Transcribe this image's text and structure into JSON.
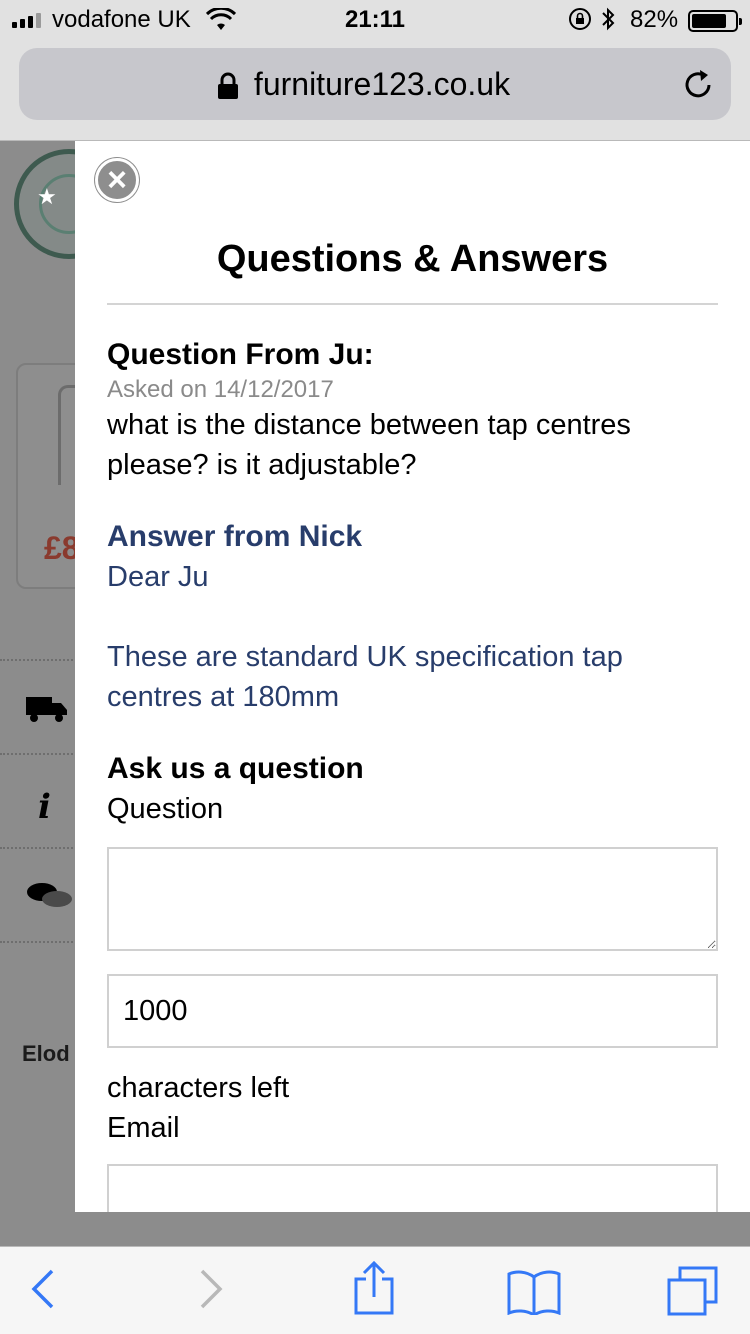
{
  "status_bar": {
    "carrier": "vodafone UK",
    "time": "21:11",
    "battery_percent": "82%",
    "battery_level": 0.82,
    "signal_bars": 3
  },
  "browser": {
    "url": "furniture123.co.uk",
    "icons": [
      "lock-icon",
      "reload-icon",
      "back-icon",
      "forward-icon",
      "share-icon",
      "bookmarks-icon",
      "tabs-icon"
    ]
  },
  "background_page": {
    "price_fragment": "£8",
    "text_fragment": "Elod"
  },
  "modal": {
    "title": "Questions & Answers",
    "question": {
      "from": "Question From Ju:",
      "date": "Asked on 14/12/2017",
      "text": "what is the distance between tap centres please? is it adjustable?"
    },
    "answer": {
      "from": "Answer from Nick",
      "greeting": "Dear Ju",
      "body": "These are standard UK specification tap centres at 180mm"
    },
    "ask": {
      "title": "Ask us a question",
      "question_label": "Question",
      "question_value": "",
      "characters_left_value": "1000",
      "characters_left_label": "characters left",
      "email_label": "Email",
      "email_value": ""
    }
  },
  "colors": {
    "answer_blue": "#283d6b",
    "overlay_grey": "#8c8c8c",
    "ios_blue": "#3478f6"
  }
}
